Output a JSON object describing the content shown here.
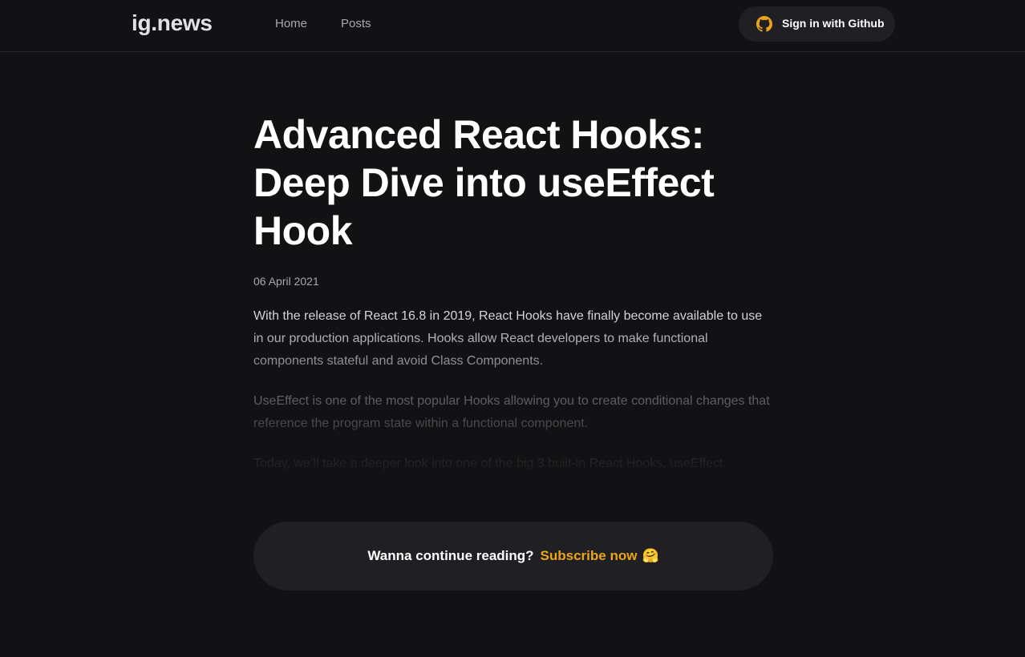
{
  "header": {
    "logo": "ig.news",
    "nav": [
      {
        "label": "Home"
      },
      {
        "label": "Posts"
      }
    ],
    "signin": {
      "label": "Sign in with Github",
      "icon": "github-icon",
      "icon_color": "#eba417"
    }
  },
  "post": {
    "title": "Advanced React Hooks: Deep Dive into useEffect Hook",
    "date": "06 April 2021",
    "paragraphs": [
      "With the release of React 16.8 in 2019, React Hooks have finally become available to use in our production applications. Hooks allow React developers to make functional components stateful and avoid Class Components.",
      "UseEffect is one of the most popular Hooks allowing you to create conditional changes that reference the program state within a functional component.",
      "Today, we’ll take a deeper look into one of the big 3 built-in React Hooks, useEffect."
    ]
  },
  "cta": {
    "text": "Wanna continue reading?",
    "link": "Subscribe now",
    "emoji": "🤗"
  },
  "colors": {
    "background": "#121214",
    "accent": "#eba417",
    "surface": "#202024"
  }
}
